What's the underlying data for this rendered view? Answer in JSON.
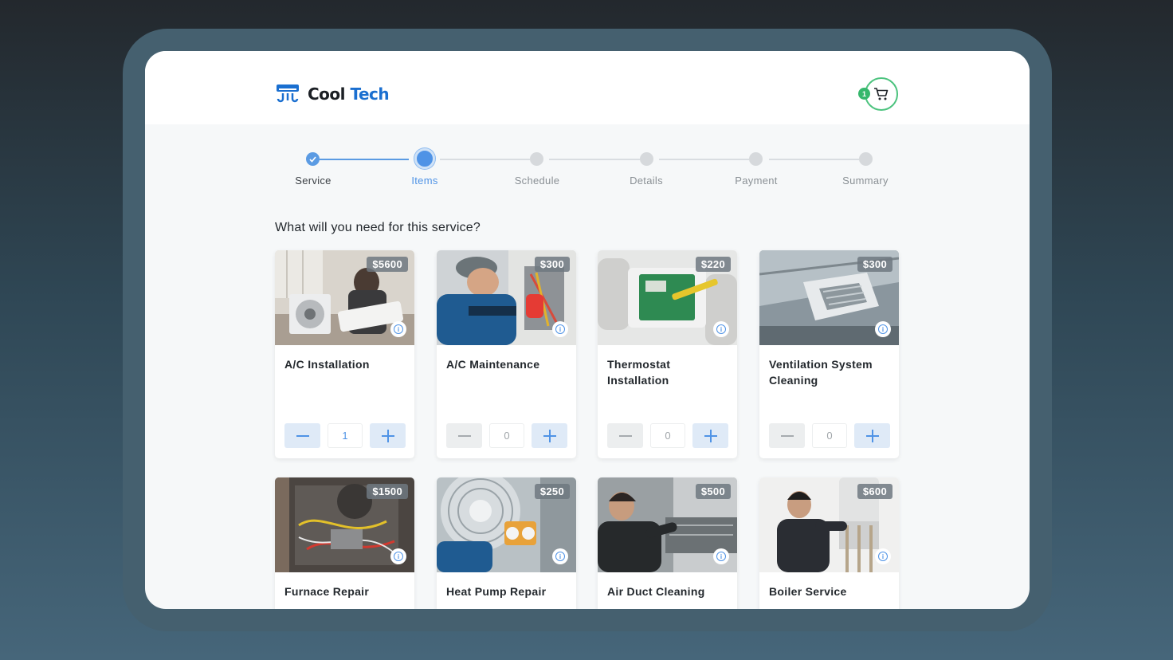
{
  "brand": {
    "name_part1": "Cool",
    "name_part2": "Tech",
    "accent": "#1a6fd0"
  },
  "cart": {
    "count": "1",
    "icon": "cart-icon"
  },
  "steps": [
    {
      "label": "Service",
      "state": "done"
    },
    {
      "label": "Items",
      "state": "active"
    },
    {
      "label": "Schedule",
      "state": "pending"
    },
    {
      "label": "Details",
      "state": "pending"
    },
    {
      "label": "Payment",
      "state": "pending"
    },
    {
      "label": "Summary",
      "state": "pending"
    }
  ],
  "question": "What will you need for this service?",
  "services": [
    {
      "title": "A/C Installation",
      "price": "$5600",
      "qty": "1"
    },
    {
      "title": "A/C Maintenance",
      "price": "$300",
      "qty": "0"
    },
    {
      "title": "Thermostat Installation",
      "price": "$220",
      "qty": "0"
    },
    {
      "title": "Ventilation System Cleaning",
      "price": "$300",
      "qty": "0"
    },
    {
      "title": "Furnace Repair",
      "price": "$1500"
    },
    {
      "title": "Heat Pump Repair",
      "price": "$250"
    },
    {
      "title": "Air Duct Cleaning",
      "price": "$500"
    },
    {
      "title": "Boiler Service",
      "price": "$600"
    }
  ],
  "colors": {
    "primary": "#4f93e6",
    "success": "#36b76c"
  }
}
